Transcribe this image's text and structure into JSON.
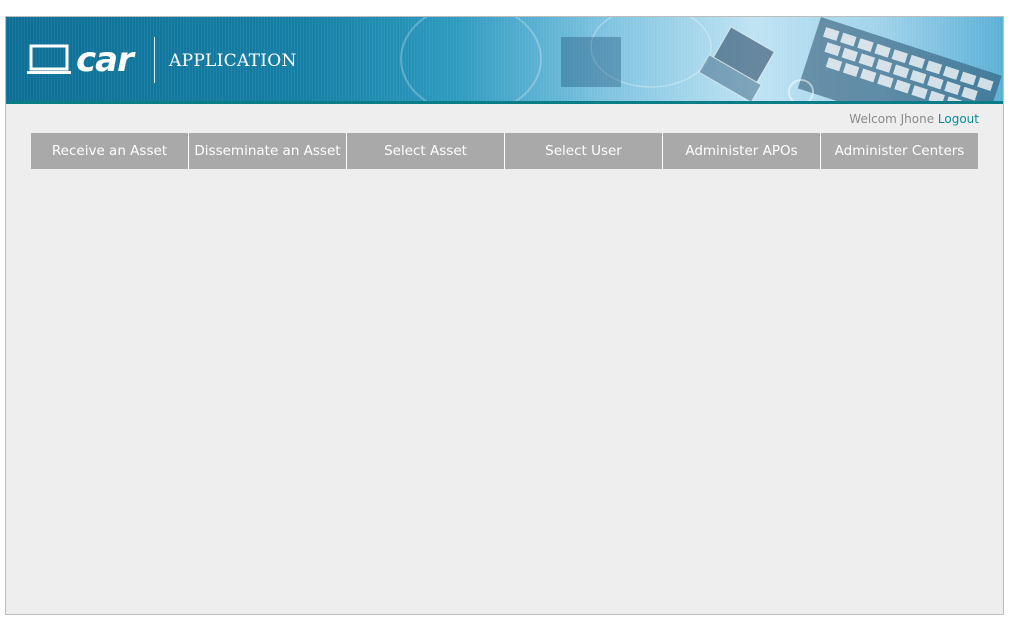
{
  "header": {
    "logo_text": "car",
    "app_title": "APPLICATION"
  },
  "user": {
    "welcome_text": "Welcom Jhone",
    "logout_label": "Logout"
  },
  "nav": {
    "items": [
      {
        "label": "Receive an Asset"
      },
      {
        "label": "Disseminate an Asset"
      },
      {
        "label": "Select Asset"
      },
      {
        "label": "Select User"
      },
      {
        "label": "Administer APOs"
      },
      {
        "label": "Administer Centers"
      }
    ]
  },
  "colors": {
    "header_blue": "#0e6f95",
    "nav_gray": "#a9a9a9",
    "link_teal": "#0a8a98",
    "content_bg": "#eeeeee"
  }
}
